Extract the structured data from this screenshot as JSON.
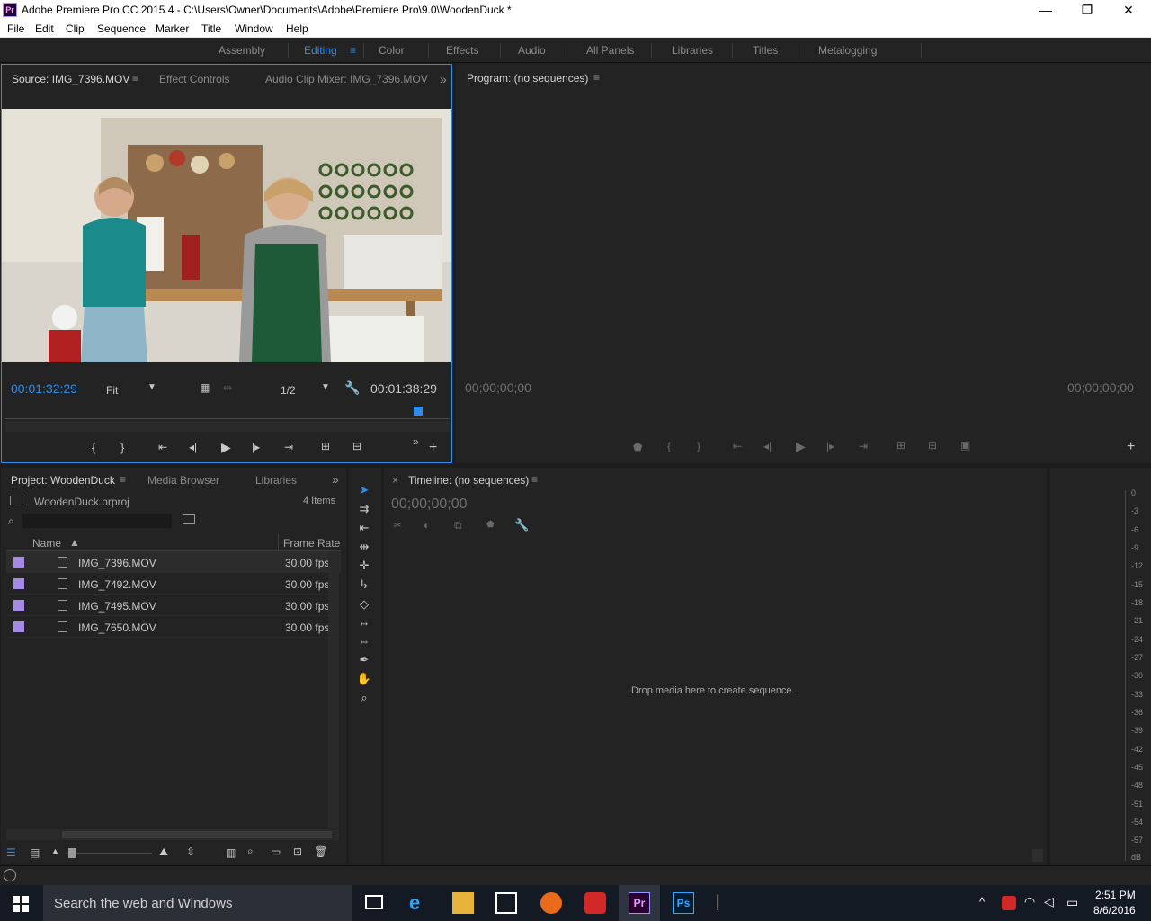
{
  "window": {
    "title": "Adobe Premiere Pro CC 2015.4 - C:\\Users\\Owner\\Documents\\Adobe\\Premiere Pro\\9.0\\WoodenDuck *",
    "logo_text": "Pr",
    "minimize": "—",
    "maximize": "❐",
    "close": "✕"
  },
  "menu": [
    "File",
    "Edit",
    "Clip",
    "Sequence",
    "Marker",
    "Title",
    "Window",
    "Help"
  ],
  "workspaces": {
    "items": [
      "Assembly",
      "Editing",
      "Color",
      "Effects",
      "Audio",
      "All Panels",
      "Libraries",
      "Titles",
      "Metalogging"
    ],
    "active": "Editing"
  },
  "source_panel": {
    "tabs": [
      "Source: IMG_7396.MOV",
      "Effect Controls",
      "Audio Clip Mixer: IMG_7396.MOV"
    ],
    "overflow": "»",
    "timecode_in": "00:01:32:29",
    "timecode_duration": "00:01:38:29",
    "zoom": "Fit",
    "resolution": "1/2",
    "playhead_fraction": 0.93
  },
  "program_panel": {
    "tab": "Program: (no sequences)",
    "timecode_left": "00;00;00;00",
    "timecode_right": "00;00;00;00"
  },
  "project_panel": {
    "tabs": [
      "Project: WoodenDuck",
      "Media Browser",
      "Libraries"
    ],
    "overflow": "»",
    "project_file": "WoodenDuck.prproj",
    "item_count": "4 Items",
    "columns": {
      "name": "Name",
      "frame_rate": "Frame Rate"
    },
    "rows": [
      {
        "name": "IMG_7396.MOV",
        "frame_rate": "30.00 fps"
      },
      {
        "name": "IMG_7492.MOV",
        "frame_rate": "30.00 fps"
      },
      {
        "name": "IMG_7495.MOV",
        "frame_rate": "30.00 fps"
      },
      {
        "name": "IMG_7650.MOV",
        "frame_rate": "30.00 fps"
      }
    ],
    "swatch_color": "#a48ae6"
  },
  "timeline_panel": {
    "tab": "Timeline: (no sequences)",
    "close": "×",
    "timecode": "00;00;00;00",
    "empty_message": "Drop media here to create sequence."
  },
  "audio_meter": {
    "labels": [
      "0",
      "-3",
      "-6",
      "-9",
      "-12",
      "-15",
      "-18",
      "-21",
      "-24",
      "-27",
      "-30",
      "-33",
      "-36",
      "-39",
      "-42",
      "-45",
      "-48",
      "-51",
      "-54",
      "-57",
      "dB"
    ]
  },
  "taskbar": {
    "search_placeholder": "Search the web and Windows",
    "time": "2:51 PM",
    "date": "8/6/2016"
  },
  "colors": {
    "accent": "#2d8ceb",
    "panel_bg": "#232323",
    "dark_bg": "#1d1d1d",
    "taskbar": "#141a24"
  }
}
